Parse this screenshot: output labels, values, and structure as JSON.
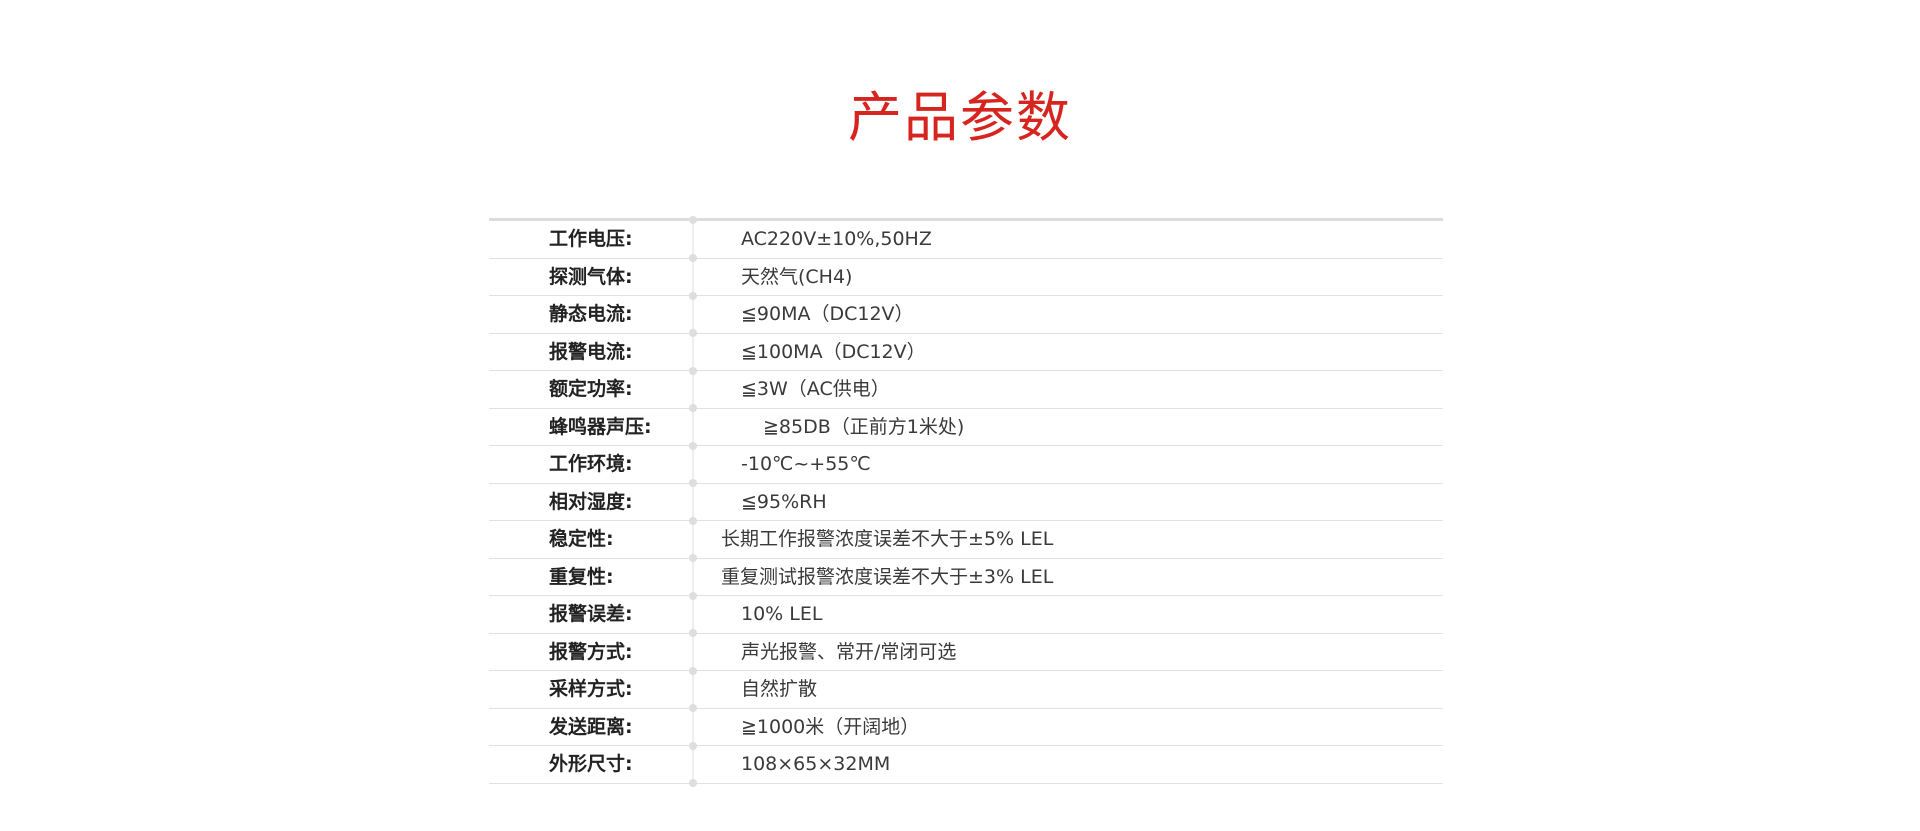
{
  "title": "产品参数",
  "specs": [
    {
      "label": "工作电压:",
      "value": "AC220V±10%,50HZ"
    },
    {
      "label": "探测气体:",
      "value": "天然气(CH4)"
    },
    {
      "label": "静态电流:",
      "value": "≦90MA（DC12V）"
    },
    {
      "label": "报警电流:",
      "value": "≦100MA（DC12V）"
    },
    {
      "label": "额定功率:",
      "value": "≦3W（AC供电）"
    },
    {
      "label": "蜂鸣器声压:",
      "value": "≧85DB（正前方1米处)"
    },
    {
      "label": "工作环境:",
      "value": "-10℃~+55℃"
    },
    {
      "label": "相对湿度:",
      "value": "≦95%RH"
    },
    {
      "label": "稳定性:",
      "value": "长期工作报警浓度误差不大于±5% LEL"
    },
    {
      "label": "重复性:",
      "value": "重复测试报警浓度误差不大于±3% LEL"
    },
    {
      "label": "报警误差:",
      "value": "10% LEL"
    },
    {
      "label": "报警方式:",
      "value": "声光报警、常开/常闭可选"
    },
    {
      "label": "采样方式:",
      "value": "自然扩散"
    },
    {
      "label": "发送距离:",
      "value": "≧1000米（开阔地）"
    },
    {
      "label": "外形尺寸:",
      "value": "108×65×32MM"
    }
  ]
}
